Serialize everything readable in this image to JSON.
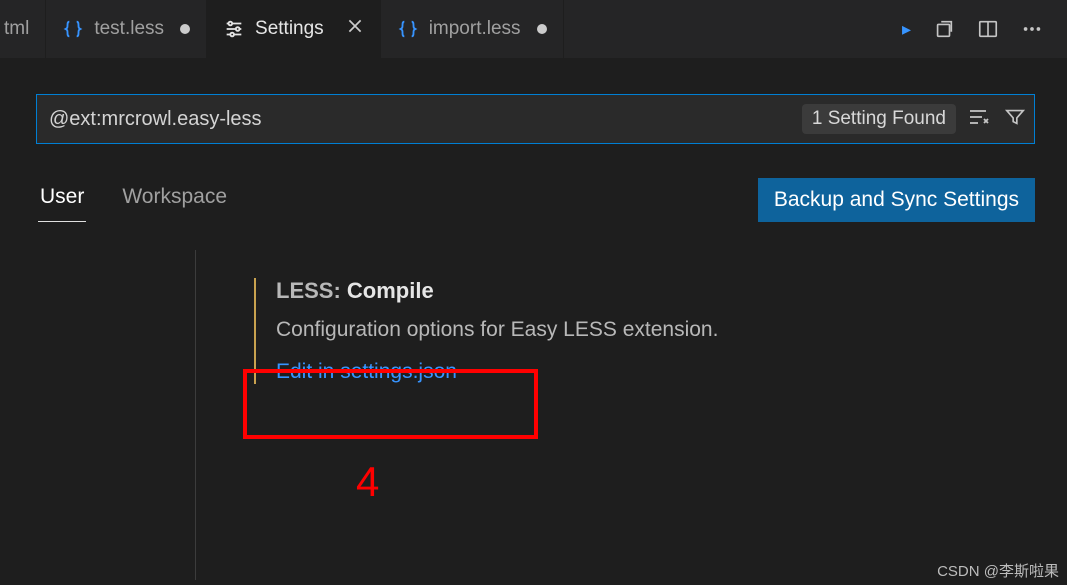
{
  "tabs": [
    {
      "label": "tml",
      "icon": "html"
    },
    {
      "label": "test.less",
      "icon": "less",
      "dirty": true
    },
    {
      "label": "Settings",
      "icon": "sliders",
      "active": true
    },
    {
      "label": "import.less",
      "icon": "less",
      "dirty": true
    }
  ],
  "search": {
    "value": "@ext:mrcrowl.easy-less",
    "resultBadge": "1 Setting Found"
  },
  "scope": {
    "user": "User",
    "workspace": "Workspace",
    "syncButton": "Backup and Sync Settings"
  },
  "setting": {
    "category": "LESS: ",
    "name": "Compile",
    "description": "Configuration options for Easy LESS extension.",
    "editLink": "Edit in settings.json"
  },
  "annotation": {
    "number": "4"
  },
  "watermark": "CSDN @李斯啦果",
  "colors": {
    "accent": "#007fd4",
    "link": "#3794ff",
    "modifiedBar": "#c9a24f",
    "highlight": "#ff0000"
  }
}
